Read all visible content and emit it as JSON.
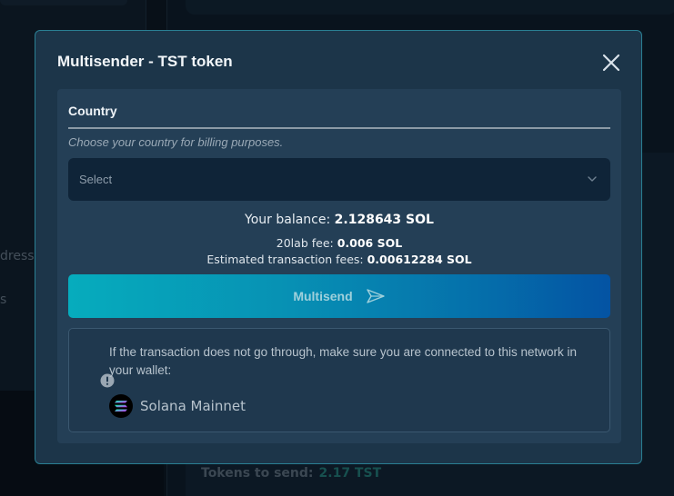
{
  "background": {
    "left_text_1": "dress",
    "left_text_2": "s",
    "tokens_label": "Tokens to send:",
    "tokens_value": "2.17 TST"
  },
  "modal": {
    "title": "Multisender - TST token",
    "close_icon": "close-icon",
    "country": {
      "label": "Country",
      "hint": "Choose your country for billing purposes.",
      "select_value": "Select"
    },
    "balance": {
      "label": "Your balance:",
      "value": "2.128643 SOL"
    },
    "fee": {
      "label": "20lab fee:",
      "value": "0.006 SOL"
    },
    "tx_fee": {
      "label": "Estimated transaction fees:",
      "value": "0.00612284 SOL"
    },
    "multisend_button": {
      "label": "Multisend",
      "icon": "send-icon"
    },
    "notice": {
      "icon": "info-icon",
      "text": "If the transaction does not go through, make sure you are connected to this network in your wallet:",
      "network_name": "Solana Mainnet",
      "network_icon": "solana-logo-icon"
    }
  },
  "colors": {
    "accent_border": "#2a7f93",
    "button_gradient_start": "#06acbd",
    "button_gradient_end": "#0453a3"
  }
}
